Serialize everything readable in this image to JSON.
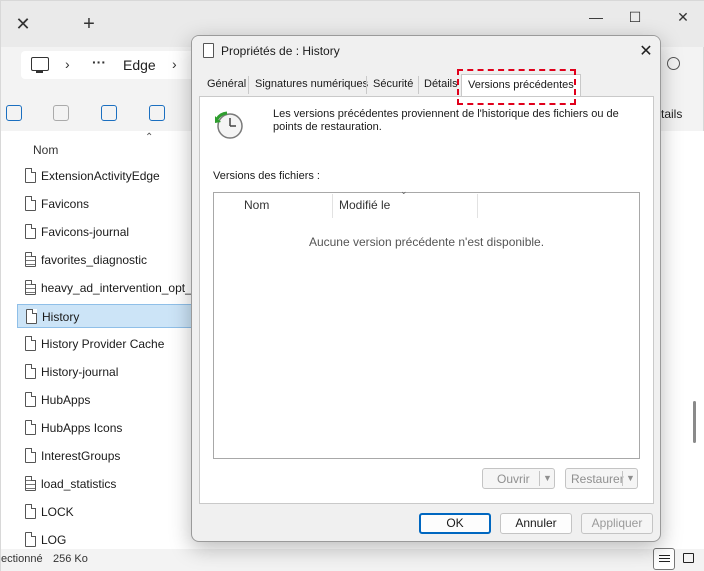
{
  "explorer": {
    "address": {
      "location": "Edge",
      "ellipsis": "···",
      "chevron": "›"
    },
    "tab": {
      "close": "✕",
      "add": "+"
    },
    "window": {
      "minimize": "—",
      "maximize": "☐",
      "close": "✕"
    },
    "toolbar": {
      "details_partial": "tails"
    },
    "column_header": "Nom",
    "files": [
      {
        "name": "ExtensionActivityEdge",
        "lines": false
      },
      {
        "name": "Favicons",
        "lines": false
      },
      {
        "name": "Favicons-journal",
        "lines": false
      },
      {
        "name": "favorites_diagnostic",
        "lines": true
      },
      {
        "name": "heavy_ad_intervention_opt_o",
        "lines": true
      },
      {
        "name": "History",
        "lines": false,
        "selected": true
      },
      {
        "name": "History Provider Cache",
        "lines": false
      },
      {
        "name": "History-journal",
        "lines": false
      },
      {
        "name": "HubApps",
        "lines": false
      },
      {
        "name": "HubApps Icons",
        "lines": false
      },
      {
        "name": "InterestGroups",
        "lines": false
      },
      {
        "name": "load_statistics",
        "lines": true
      },
      {
        "name": "LOCK",
        "lines": false
      },
      {
        "name": "LOG",
        "lines": false
      }
    ],
    "status": {
      "selection": "ectionné",
      "size": "256 Ko"
    }
  },
  "dialog": {
    "title": "Propriétés de : History",
    "close": "✕",
    "tabs": [
      "Général",
      "Signatures numériques",
      "Sécurité",
      "Détails",
      "Versions précédentes"
    ],
    "active_tab": "Versions précédentes",
    "intro": "Les versions précédentes proviennent de l'historique des fichiers ou de points de restauration.",
    "section_label": "Versions des fichiers :",
    "columns": {
      "name": "Nom",
      "modified": "Modifié le"
    },
    "empty_message": "Aucune version précédente n'est disponible.",
    "open_button": "Ouvrir",
    "restore_button": "Restaurer",
    "ok_button": "OK",
    "cancel_button": "Annuler",
    "apply_button": "Appliquer"
  },
  "colors": {
    "highlight": "#e0001b",
    "accent": "#0067c0",
    "selection": "#cce4f7"
  }
}
